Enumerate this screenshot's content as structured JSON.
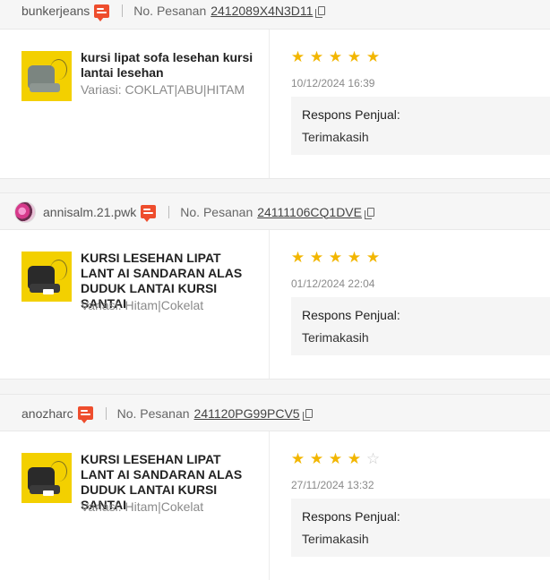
{
  "labels": {
    "order_label": "No. Pesanan",
    "seller_response_label": "Respons Penjual:"
  },
  "colors": {
    "star": "#f2b600",
    "chat_icon": "#ee4d2d"
  },
  "reviews": [
    {
      "username": "bunkerjeans",
      "has_avatar": false,
      "order_no": "2412089X4N3D11",
      "product_name": "kursi lipat sofa lesehan kursi lantai lesehan",
      "variation": "Variasi: COKLAT|ABU|HITAM",
      "rating": 5,
      "date": "10/12/2024 16:39",
      "seller_response": "Terimakasih"
    },
    {
      "username": "annisalm.21.pwk",
      "has_avatar": true,
      "order_no": "24111106CQ1DVE",
      "product_name": "KURSI LESEHAN LIPAT LANT AI SANDARAN ALAS DUDUK LANTAI KURSI SANTAI",
      "variation": "Variasi: Hitam|Cokelat",
      "rating": 5,
      "date": "01/12/2024 22:04",
      "seller_response": "Terimakasih"
    },
    {
      "username": "anozharc",
      "has_avatar": false,
      "order_no": "241120PG99PCV5",
      "product_name": "KURSI LESEHAN LIPAT LANT AI SANDARAN ALAS DUDUK LANTAI KURSI SANTAI",
      "variation": "Variasi: Hitam|Cokelat",
      "rating": 4,
      "date": "27/11/2024 13:32",
      "seller_response": "Terimakasih"
    }
  ]
}
